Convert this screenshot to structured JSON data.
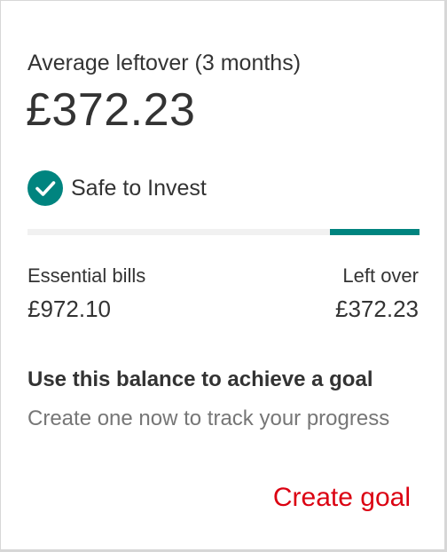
{
  "summary": {
    "heading": "Average leftover (3 months)",
    "amount": "£372.23"
  },
  "status": {
    "icon": "check-circle-icon",
    "icon_color": "#00847f",
    "label": "Safe to Invest"
  },
  "progress": {
    "leftover_fraction": 0.228,
    "fill_color": "#00847f",
    "track_color": "#f1f1f1"
  },
  "breakdown": {
    "essential_label": "Essential bills",
    "essential_value": "£972.10",
    "leftover_label": "Left over",
    "leftover_value": "£372.23"
  },
  "goal": {
    "title": "Use this balance to achieve a goal",
    "description": "Create one now to track your progress",
    "button_label": "Create goal",
    "button_color": "#db0011"
  }
}
